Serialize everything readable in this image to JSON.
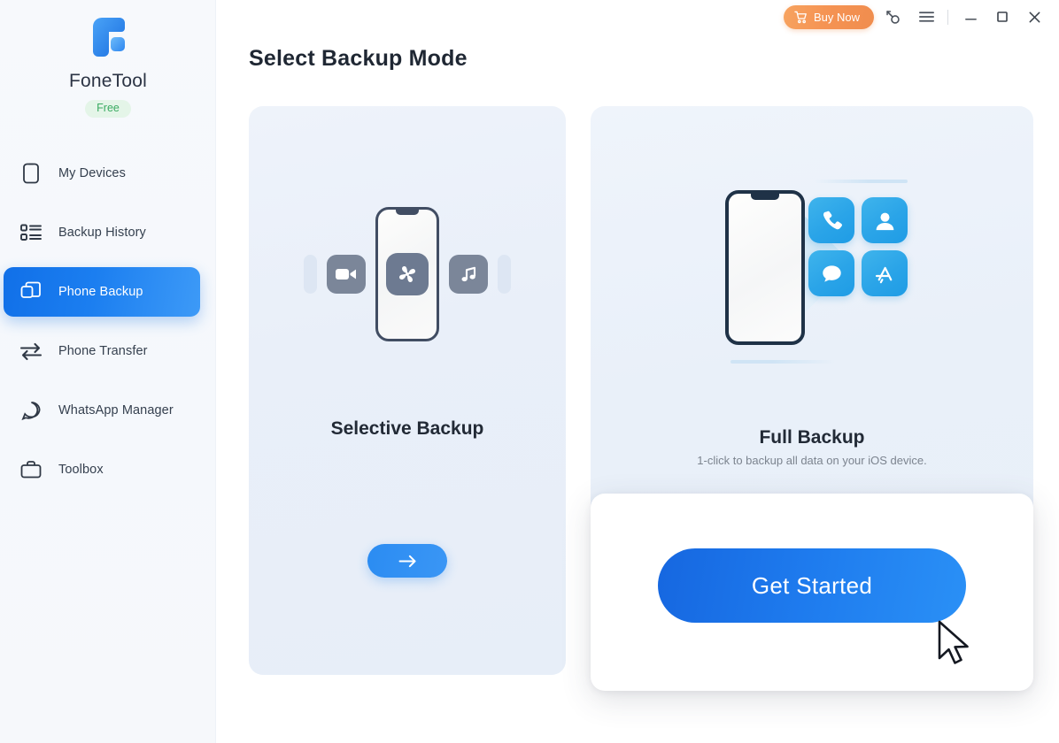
{
  "app": {
    "brand_name": "FoneTool",
    "plan_badge": "Free",
    "logo_icon": "fonetool-logo-icon"
  },
  "sidebar": {
    "items": [
      {
        "label": "My Devices",
        "icon": "phone-outline-icon",
        "active": false
      },
      {
        "label": "Backup History",
        "icon": "list-icon",
        "active": false
      },
      {
        "label": "Phone Backup",
        "icon": "copy-layers-icon",
        "active": true
      },
      {
        "label": "Phone Transfer",
        "icon": "transfer-arrows-icon",
        "active": false
      },
      {
        "label": "WhatsApp Manager",
        "icon": "chat-bubble-icon",
        "active": false
      },
      {
        "label": "Toolbox",
        "icon": "toolbox-icon",
        "active": false
      }
    ]
  },
  "topbar": {
    "buy_now_label": "Buy Now",
    "buy_now_icon": "shopping-cart-icon",
    "key_icon": "key-icon",
    "menu_icon": "hamburger-menu-icon",
    "minimize_icon": "minimize-icon",
    "maximize_icon": "maximize-icon",
    "close_icon": "close-icon"
  },
  "main": {
    "page_title": "Select Backup Mode",
    "cards": [
      {
        "title": "Selective Backup",
        "subtitle": "",
        "action_icon": "arrow-right-icon",
        "illustration": {
          "center_app_icon": "photos-icon",
          "left_tile_icon": "video-camera-icon",
          "right_tile_icon": "music-note-icon"
        }
      },
      {
        "title": "Full Backup",
        "subtitle": "1-click to backup all data on your iOS device.",
        "illustration": {
          "app_icons": [
            "phone-icon",
            "contact-icon",
            "message-icon",
            "app-store-icon"
          ]
        }
      }
    ]
  },
  "overlay": {
    "get_started_label": "Get Started",
    "cursor_icon": "mouse-pointer-icon"
  },
  "colors": {
    "accent_blue": "#1e7bee",
    "buy_now_orange": "#f59353",
    "free_green": "#3aab62",
    "card_bg": "#e9eff9",
    "sidebar_bg": "#f6f8fb"
  }
}
